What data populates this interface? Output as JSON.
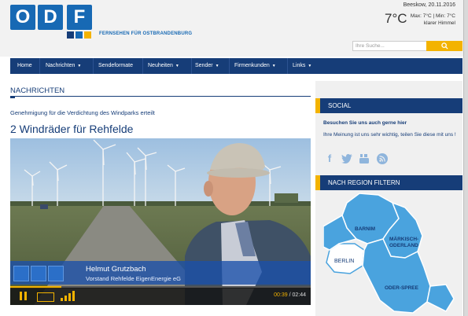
{
  "header": {
    "logo_letters": [
      "O",
      "D",
      "F"
    ],
    "tagline": "FERNSEHEN FÜR OSTBRANDENBURG",
    "date_location": "Beeskow, 20.11.2016",
    "temperature": "7°C",
    "weather_minmax": "Max: 7°C | Min: 7°C",
    "weather_desc": "klarer Himmel",
    "search_placeholder": "Ihre Suche...",
    "search_icon": "magnifier-icon"
  },
  "nav": {
    "items": [
      {
        "label": "Home",
        "dropdown": false
      },
      {
        "label": "Nachrichten",
        "dropdown": true
      },
      {
        "label": "Sendeformate",
        "dropdown": false
      },
      {
        "label": "Neuheiten",
        "dropdown": true
      },
      {
        "label": "Sender",
        "dropdown": true
      },
      {
        "label": "Firmenkunden",
        "dropdown": true
      },
      {
        "label": "Links",
        "dropdown": true
      }
    ]
  },
  "main": {
    "section_title": "NACHRICHTEN",
    "teaser": "Genehmigung für die Verdichtung des Windparks erteilt",
    "headline": "2 Windräder für Rehfelde",
    "video": {
      "lower_third_name": "Helmut Grutzbach",
      "lower_third_role": "Vorstand Rehfelde EigenEnergie eG",
      "time_current": "00:39",
      "time_total": "02:44",
      "progress_fraction": 0.17
    }
  },
  "sidebar": {
    "social_title": "SOCIAL",
    "social_subtitle": "Besuchen Sie uns auch gerne hier",
    "social_text": "Ihre Meinung ist uns sehr wichtig, teilen Sie diese mit uns !",
    "social_icons": [
      "facebook-icon",
      "twitter-icon",
      "youtube-icon",
      "rss-icon"
    ],
    "region_title": "NACH REGION FILTERN",
    "regions": [
      "BARNIM",
      "MÄRKISCH-ODERLAND",
      "BERLIN",
      "ODER-SPREE"
    ]
  },
  "colors": {
    "brand_blue": "#163d78",
    "logo_blue": "#1769b4",
    "accent_yellow": "#f3b300",
    "map_blue": "#4aa3de"
  }
}
